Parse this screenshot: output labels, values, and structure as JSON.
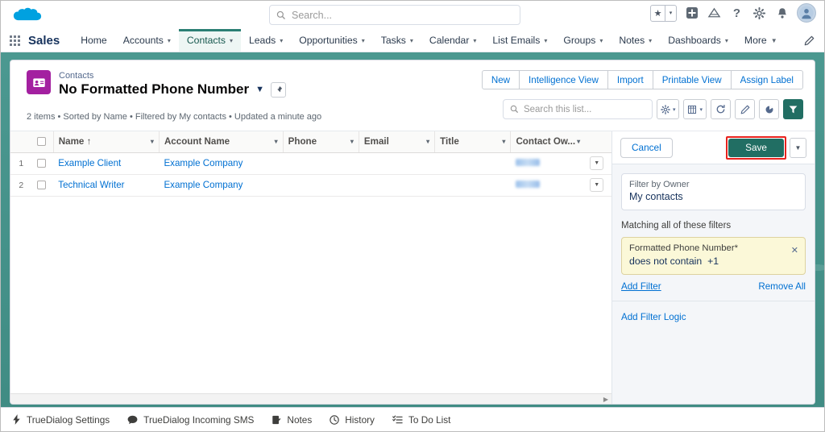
{
  "header": {
    "logo_icon": "salesforce-cloud-logo",
    "search": {
      "placeholder": "Search...",
      "icon": "search-icon"
    },
    "icons": [
      {
        "name": "favorites-star-icon",
        "glyph": "★"
      },
      {
        "name": "favorites-dropdown-icon",
        "glyph": "▾"
      },
      {
        "name": "add-icon",
        "glyph": "+"
      },
      {
        "name": "app-launcher-cloud-icon",
        "glyph": "⛰"
      },
      {
        "name": "help-icon",
        "glyph": "?"
      },
      {
        "name": "setup-gear-icon",
        "glyph": "⚙"
      },
      {
        "name": "notifications-bell-icon",
        "glyph": "🔔"
      },
      {
        "name": "user-avatar",
        "glyph": "👤"
      }
    ]
  },
  "nav": {
    "app_launcher_icon": "app-launcher-waffle-icon",
    "app_name": "Sales",
    "tabs": [
      {
        "label": "Home",
        "has_caret": false,
        "active": false
      },
      {
        "label": "Accounts",
        "has_caret": true,
        "active": false
      },
      {
        "label": "Contacts",
        "has_caret": true,
        "active": true
      },
      {
        "label": "Leads",
        "has_caret": true,
        "active": false
      },
      {
        "label": "Opportunities",
        "has_caret": true,
        "active": false
      },
      {
        "label": "Tasks",
        "has_caret": true,
        "active": false
      },
      {
        "label": "Calendar",
        "has_caret": true,
        "active": false
      },
      {
        "label": "List Emails",
        "has_caret": true,
        "active": false
      },
      {
        "label": "Groups",
        "has_caret": true,
        "active": false
      },
      {
        "label": "Notes",
        "has_caret": true,
        "active": false
      },
      {
        "label": "Dashboards",
        "has_caret": true,
        "active": false
      },
      {
        "label": "More",
        "has_caret": true,
        "active": false
      }
    ],
    "edit_icon": "pencil-edit-icon"
  },
  "listview": {
    "object_icon": "contacts-object-icon",
    "breadcrumb": "Contacts",
    "title": "No Formatted Phone Number",
    "title_caret_icon": "chevron-down-icon",
    "pin_icon": "pin-icon",
    "meta": "2 items • Sorted by Name • Filtered by My contacts • Updated a minute ago",
    "actions": [
      "New",
      "Intelligence View",
      "Import",
      "Printable View",
      "Assign Label"
    ],
    "search_placeholder": "Search this list...",
    "search_icon": "search-icon",
    "tools": [
      {
        "name": "list-settings-gear-button",
        "glyph": "⚙",
        "caret": true,
        "active": false
      },
      {
        "name": "table-display-button",
        "glyph": "▤",
        "caret": true,
        "active": false
      },
      {
        "name": "refresh-button",
        "glyph": "↻",
        "caret": false,
        "active": false
      },
      {
        "name": "edit-pencil-button",
        "glyph": "✎",
        "caret": false,
        "active": false
      },
      {
        "name": "charts-button",
        "glyph": "◔",
        "caret": false,
        "active": false
      },
      {
        "name": "filter-funnel-button",
        "glyph": "▼",
        "caret": false,
        "active": true
      }
    ]
  },
  "table": {
    "columns": [
      "Name",
      "Account Name",
      "Phone",
      "Email",
      "Title",
      "Contact Ow..."
    ],
    "sorted_column": "Name",
    "sort_indicator": "↑",
    "column_menu_icon": "chevron-down-icon",
    "select_all_checkbox": "select-all-checkbox",
    "rows": [
      {
        "num": "1",
        "name": "Example Client",
        "account": "Example Company",
        "phone": "",
        "email": "",
        "title": "",
        "owner_redacted": true
      },
      {
        "num": "2",
        "name": "Technical Writer",
        "account": "Example Company",
        "phone": "",
        "email": "",
        "title": "",
        "owner_redacted": true
      }
    ]
  },
  "filter_panel": {
    "cancel_label": "Cancel",
    "save_label": "Save",
    "save_caret_icon": "chevron-down-icon",
    "save_highlight_color": "#e8221d",
    "save_button_color": "#216e63",
    "owner_filter_label": "Filter by Owner",
    "owner_filter_value": "My contacts",
    "matching_label": "Matching all of these filters",
    "filters": [
      {
        "field": "Formatted Phone Number*",
        "condition": "does not contain",
        "value": "+1",
        "remove_icon": "close-x-icon"
      }
    ],
    "add_filter_label": "Add Filter",
    "remove_all_label": "Remove All",
    "add_filter_logic_label": "Add Filter Logic"
  },
  "utility_bar": [
    {
      "label": "TrueDialog Settings",
      "icon": "lightning-bolt-icon",
      "glyph": "⚡"
    },
    {
      "label": "TrueDialog Incoming SMS",
      "icon": "chat-bubble-icon",
      "glyph": "💬"
    },
    {
      "label": "Notes",
      "icon": "note-icon",
      "glyph": "🗒"
    },
    {
      "label": "History",
      "icon": "clock-icon",
      "glyph": "🕓"
    },
    {
      "label": "To Do List",
      "icon": "task-list-icon",
      "glyph": "☰"
    }
  ]
}
